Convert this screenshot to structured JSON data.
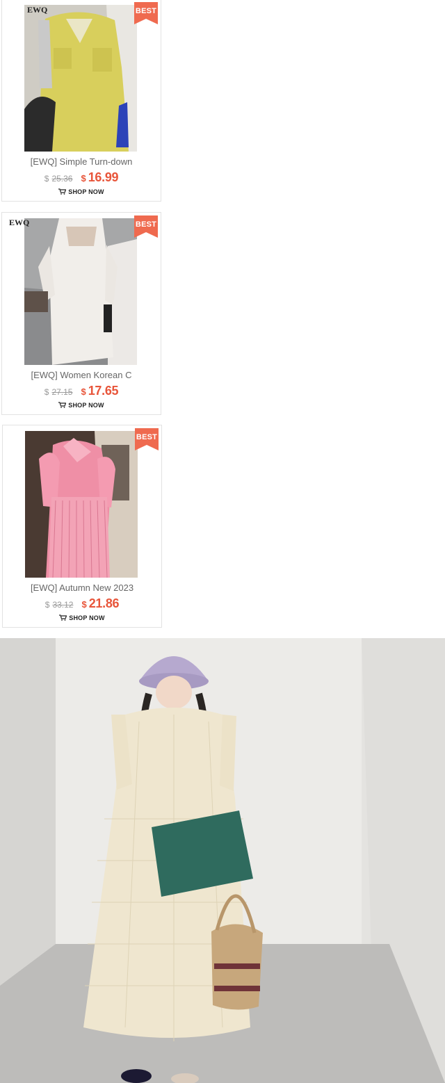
{
  "products": [
    {
      "badge": "BEST",
      "title": "[EWQ] Simple Turn-down",
      "currency": "$",
      "old_price": "25.36",
      "new_price": "16.99",
      "cta": "SHOP NOW",
      "brand_mark": "EWQ"
    },
    {
      "badge": "BEST",
      "title": "[EWQ] Women Korean C",
      "currency": "$",
      "old_price": "27.15",
      "new_price": "17.65",
      "cta": "SHOP NOW",
      "brand_mark": "EWQ"
    },
    {
      "badge": "BEST",
      "title": "[EWQ] Autumn New 2023",
      "currency": "$",
      "old_price": "33.12",
      "new_price": "21.86",
      "cta": "SHOP NOW"
    }
  ],
  "colors": {
    "accent": "#e8553a",
    "badge": "#ef6a4f"
  }
}
